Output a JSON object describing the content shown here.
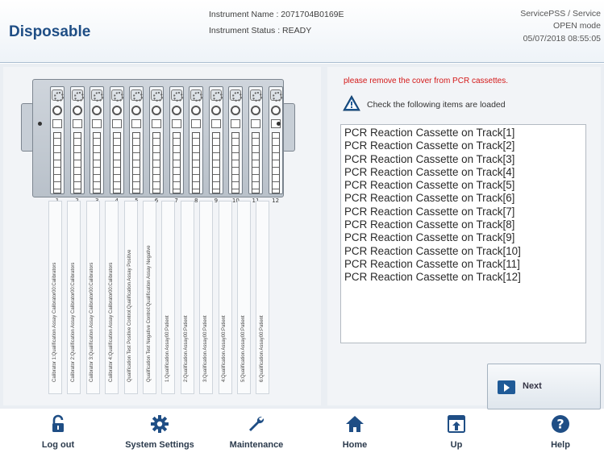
{
  "header": {
    "title": "Disposable",
    "instrument_name": "Instrument Name : 2071704B0169E",
    "instrument_status": "Instrument Status : READY",
    "user": "ServicePSS / Service",
    "mode": "OPEN mode",
    "datetime": "05/07/2018 08:55:05"
  },
  "rack": {
    "slot_numbers": [
      "1",
      "2",
      "3",
      "4",
      "5",
      "6",
      "7",
      "8",
      "9",
      "10",
      "11",
      "12"
    ]
  },
  "rack_labels": [
    "Calibrator 1:Qualification Assay Calibrator00:Calibrators",
    "Calibrator 2:Qualification Assay Calibrator00:Calibrators",
    "Calibrator 3:Qualification Assay Calibrator00:Calibrators",
    "Calibrator 4:Qualification Assay Calibrator00:Calibrators",
    "Qualification Test Positive Control:Qualification Assay Positive",
    "Qualification Test Negative Control:Qualification Assay Negative",
    "1:Qualification Assay00:Patient",
    "2:Qualification Assay00:Patient",
    "3:Qualification Assay00:Patient",
    "4:Qualification Assay00:Patient",
    "5:Qualification Assay00:Patient",
    "6:Qualification Assay00:Patient"
  ],
  "instructions": {
    "warning": "please remove the cover from PCR cassettes.",
    "check": "Check the following items are loaded"
  },
  "checklist": [
    "PCR Reaction Cassette on Track[1]",
    "PCR Reaction Cassette on Track[2]",
    "PCR Reaction Cassette on Track[3]",
    "PCR Reaction Cassette on Track[4]",
    "PCR Reaction Cassette on Track[5]",
    "PCR Reaction Cassette on Track[6]",
    "PCR Reaction Cassette on Track[7]",
    "PCR Reaction Cassette on Track[8]",
    "PCR Reaction Cassette on Track[9]",
    "PCR Reaction Cassette on Track[10]",
    "PCR Reaction Cassette on Track[11]",
    "PCR Reaction Cassette on Track[12]"
  ],
  "next_button": "Next",
  "footer": {
    "logout": "Log out",
    "system_settings": "System Settings",
    "maintenance": "Maintenance",
    "home": "Home",
    "up": "Up",
    "help": "Help"
  },
  "colors": {
    "title": "#1f4e85",
    "warning": "#d41818",
    "accent": "#1f5a97"
  }
}
